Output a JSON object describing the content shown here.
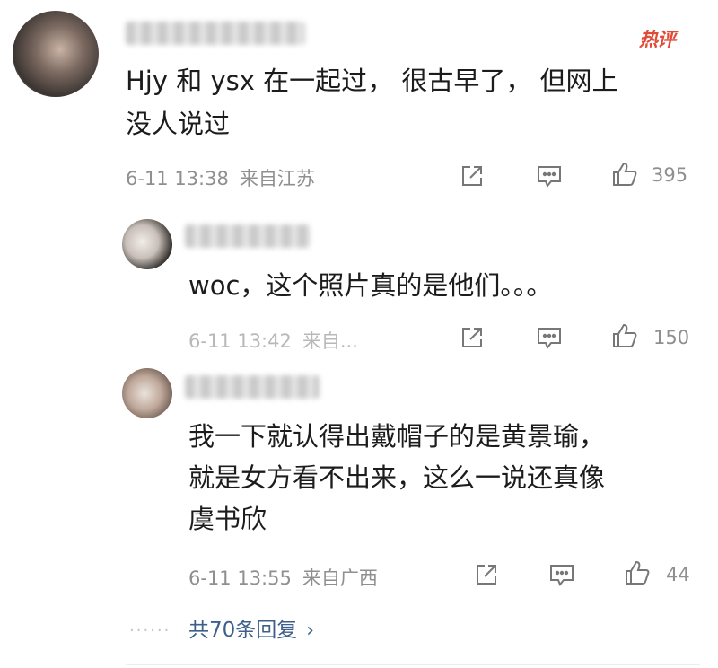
{
  "main_comment": {
    "badge": "热评",
    "text_line1": "Hjy 和 ysx 在一起过， 很古早了， 但网上",
    "text_line2": "没人说过",
    "time": "6-11 13:38",
    "location": "来自江苏",
    "likes": "395"
  },
  "replies": [
    {
      "text_line1": "woc，这个照片真的是他们。。。",
      "time": "6-11 13:42",
      "location": "来自...",
      "likes": "150"
    },
    {
      "text_line1": "我一下就认得出戴帽子的是黄景瑜，",
      "text_line2": "就是女方看不出来，这么一说还真像",
      "text_line3": "虞书欣",
      "time": "6-11 13:55",
      "location": "来自广西",
      "likes": "44"
    }
  ],
  "footer": {
    "more_replies": "共70条回复",
    "chevron": "›",
    "dots": "······"
  },
  "colors": {
    "badge": "#e04a36",
    "link": "#3e5f8a",
    "meta": "#8f8f8f"
  },
  "icons": [
    "share-icon",
    "comment-icon",
    "like-icon"
  ]
}
